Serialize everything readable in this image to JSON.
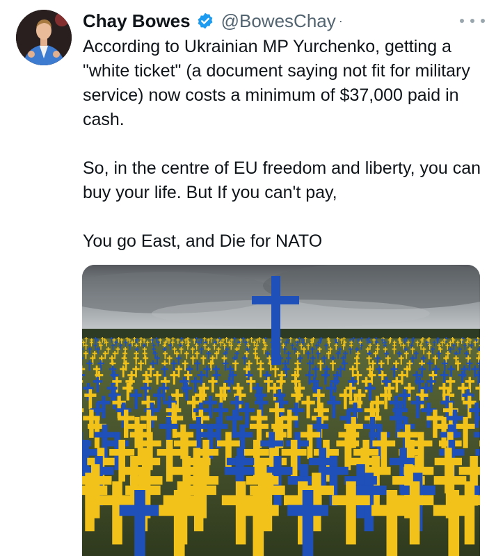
{
  "author": {
    "display_name": "Chay Bowes",
    "handle": "@BowesChay",
    "separator": "·",
    "avatar_icon": "avatar",
    "verified_icon": "verified-badge-icon",
    "verified_color": "#1d9bf0"
  },
  "menu": {
    "icon": "more-options-icon"
  },
  "text": {
    "p1": "According to Ukrainian MP Yurchenko, getting a \"white ticket\" (a document saying not fit for military service) now costs a minimum of $37,000 paid in cash.",
    "p2": "So, in the centre of EU freedom and liberty, you can buy your life. But If you can't pay,",
    "p3": "You go East, and Die for NATO"
  },
  "media": {
    "kind": "photo",
    "cross_colors": [
      "#1f4fb8",
      "#f2c21b"
    ],
    "sky_color": "#8a8f94"
  }
}
